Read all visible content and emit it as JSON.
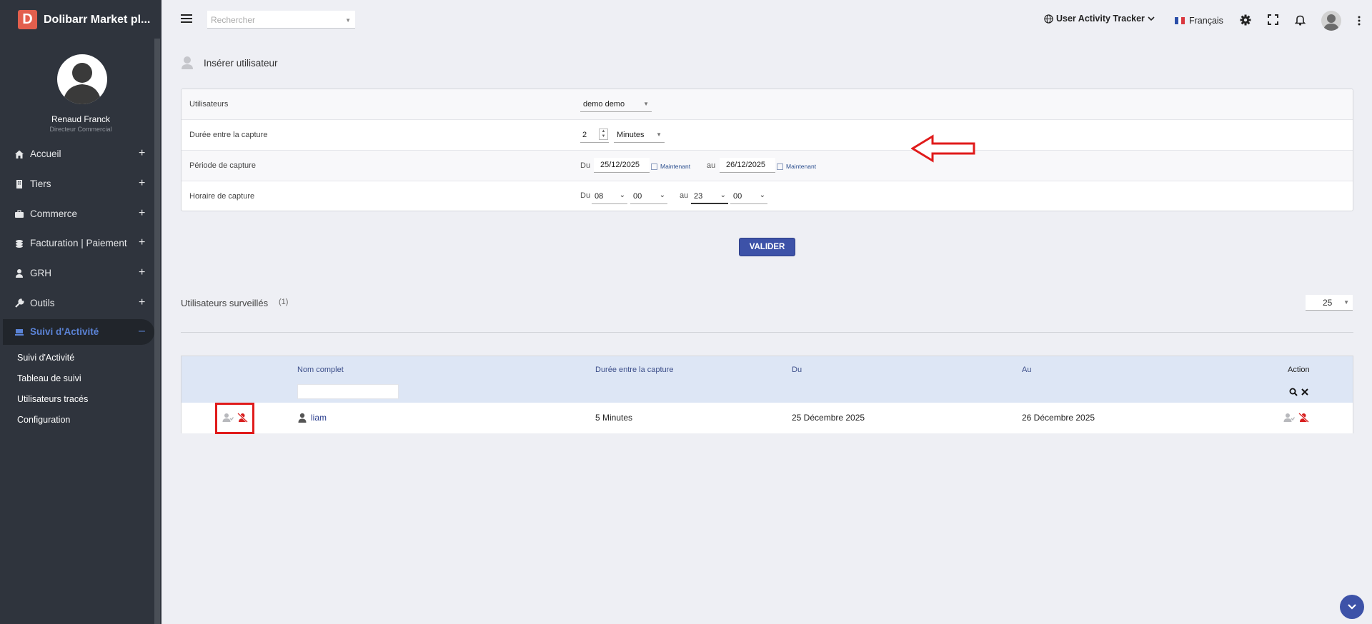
{
  "app": {
    "brand_letter": "D",
    "brand_name": "Dolibarr Market pl..."
  },
  "user": {
    "name": "Renaud Franck",
    "role": "Directeur Commercial"
  },
  "sidebar": {
    "items": [
      {
        "label": "Accueil",
        "icon": "home-icon"
      },
      {
        "label": "Tiers",
        "icon": "building-icon"
      },
      {
        "label": "Commerce",
        "icon": "briefcase-icon"
      },
      {
        "label": "Facturation | Paiement",
        "icon": "money-icon"
      },
      {
        "label": "GRH",
        "icon": "user-icon"
      },
      {
        "label": "Outils",
        "icon": "wrench-icon"
      },
      {
        "label": "Suivi d'Activité",
        "icon": "activity-icon",
        "active": true
      }
    ],
    "plus": "+",
    "minus": "–",
    "subitems": [
      "Suivi d'Activité",
      "Tableau de suivi",
      "Utilisateurs tracés",
      "Configuration"
    ]
  },
  "topbar": {
    "search_placeholder": "Rechercher",
    "tracker_label": "User Activity Tracker",
    "language": "Français"
  },
  "page": {
    "title": "Insérer utilisateur"
  },
  "form": {
    "users_label": "Utilisateurs",
    "users_value": "demo demo",
    "duration_label": "Durée entre la capture",
    "duration_value": "2",
    "duration_unit": "Minutes",
    "period_label": "Période de capture",
    "period_from_label": "Du",
    "period_from": "25/12/2025",
    "period_to_label": "au",
    "period_to": "26/12/2025",
    "now_label": "Maintenant",
    "schedule_label": "Horaire de capture",
    "schedule_from_label": "Du",
    "schedule_from_hour": "08",
    "schedule_from_min": "00",
    "schedule_to_label": "au",
    "schedule_to_hour": "23",
    "schedule_to_min": "00",
    "submit": "VALIDER"
  },
  "watched": {
    "title": "Utilisateurs surveillés",
    "count": "(1)",
    "per_page": "25",
    "columns": [
      "Nom complet",
      "Durée entre la capture",
      "Du",
      "Au",
      "Action"
    ],
    "rows": [
      {
        "name": "liam",
        "duration": "5 Minutes",
        "from": "25 Décembre 2025",
        "to": "26 Décembre 2025"
      }
    ]
  },
  "colors": {
    "sidebar_bg": "#2f343d",
    "accent": "#3d52a8",
    "active_menu": "#5b83d6",
    "alert_red": "#e01b1b"
  }
}
